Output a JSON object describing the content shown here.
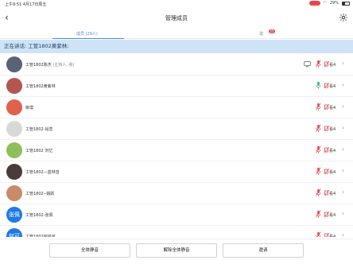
{
  "status_bar": {
    "time": "上午9:51",
    "date": "4月17日周五",
    "battery": "29%"
  },
  "nav": {
    "title": "管理成员"
  },
  "tabs": {
    "members": "成员 (29人)",
    "invite": "邀",
    "invite_badge": "25"
  },
  "speaking_text": "正在讲话: 工管1802黄紫林;",
  "view_label": "看4",
  "members": [
    {
      "name": "工管1802陈杰",
      "suffix": "(主持人, 我)",
      "avatar_color": "#5a6275"
    },
    {
      "name": "工管1802黄紫林",
      "suffix": "",
      "avatar_color": "#b3564f"
    },
    {
      "name": "柳漠",
      "suffix": "",
      "avatar_color": "#e0624a"
    },
    {
      "name": "工管1802-肖蕊",
      "suffix": "",
      "avatar_color": "#d8d8d8"
    },
    {
      "name": "工管1802 刘忆",
      "suffix": "",
      "avatar_color": "#8fbf5a"
    },
    {
      "name": "工管1802—蓝林音",
      "suffix": "",
      "avatar_color": "#4a3a3a"
    },
    {
      "name": "工管1802--姚跃",
      "suffix": "",
      "avatar_color": "#c98a6a"
    },
    {
      "name": "工管1802-张佩",
      "suffix": "",
      "avatar_color": "#1e7ae6",
      "avatar_text": "张佩"
    },
    {
      "name": "工管1802何可可",
      "suffix": "",
      "avatar_color": "#1e7ae6",
      "avatar_text": "何可"
    }
  ],
  "buttons": {
    "mute_all": "全体静音",
    "unmute_all": "解除全体静音",
    "invite": "邀请"
  },
  "colors": {
    "accent": "#4a8be0",
    "banner": "#cfe3f7",
    "speaking_mic": "#3cb371",
    "muted_mic": "#e5484d"
  }
}
